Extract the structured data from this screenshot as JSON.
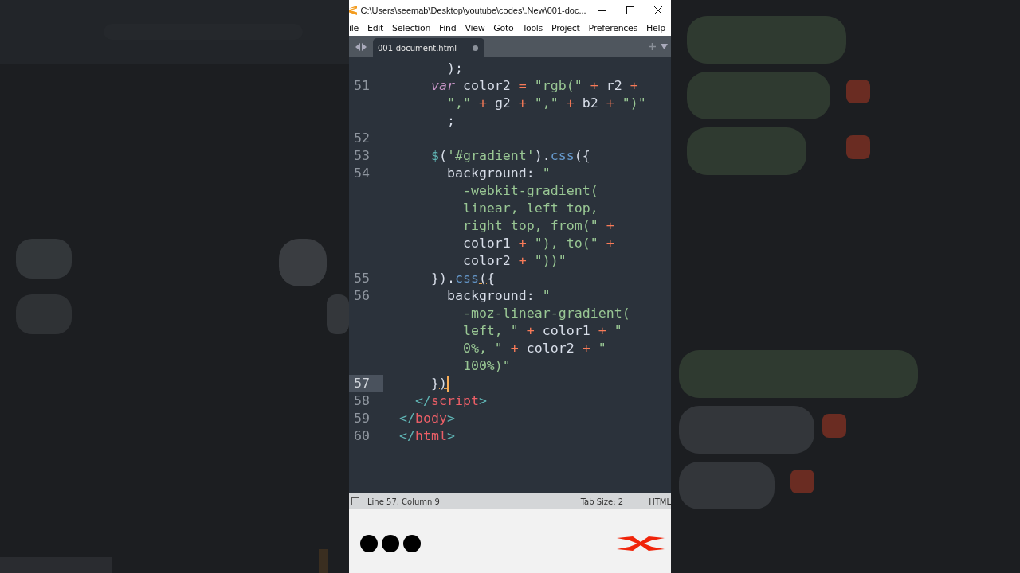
{
  "window": {
    "title": "C:\\Users\\seemab\\Desktop\\youtube\\codes\\.New\\001-doc..."
  },
  "menu": [
    "ile",
    "Edit",
    "Selection",
    "Find",
    "View",
    "Goto",
    "Tools",
    "Project",
    "Preferences",
    "Help"
  ],
  "tabs": [
    {
      "label": "001-document.html",
      "selected": true,
      "modified": true
    }
  ],
  "editor": {
    "lines": [
      {
        "segments": [
          {
            "text": "        );",
            "kind": "plain"
          }
        ]
      },
      {
        "number": "51",
        "segments": [
          {
            "text": "      var",
            "kind": "keyword"
          },
          {
            "text": " color2 ",
            "kind": "plain"
          },
          {
            "text": "=",
            "kind": "operator"
          },
          {
            "text": " \"rgb(\" ",
            "kind": "string"
          },
          {
            "text": "+",
            "kind": "operator"
          },
          {
            "text": " r2 ",
            "kind": "plain"
          },
          {
            "text": "+",
            "kind": "operator"
          }
        ]
      },
      {
        "segments": [
          {
            "text": "        \",\" ",
            "kind": "string"
          },
          {
            "text": "+",
            "kind": "operator"
          },
          {
            "text": " g2 ",
            "kind": "plain"
          },
          {
            "text": "+",
            "kind": "operator"
          },
          {
            "text": " \",\" ",
            "kind": "string"
          },
          {
            "text": "+",
            "kind": "operator"
          },
          {
            "text": " b2 ",
            "kind": "plain"
          },
          {
            "text": "+",
            "kind": "operator"
          },
          {
            "text": " \")\"",
            "kind": "string"
          }
        ]
      },
      {
        "segments": [
          {
            "text": "        ;",
            "kind": "plain"
          }
        ]
      },
      {
        "number": "52"
      },
      {
        "number": "53",
        "segments": [
          {
            "text": "      $",
            "kind": "dollar"
          },
          {
            "text": "(",
            "kind": "plain"
          },
          {
            "text": "'#gradient'",
            "kind": "string"
          },
          {
            "text": ").",
            "kind": "plain"
          },
          {
            "text": "css",
            "kind": "func"
          },
          {
            "text": "({",
            "kind": "plain"
          }
        ]
      },
      {
        "number": "54",
        "segments": [
          {
            "text": "        background: ",
            "kind": "plain"
          },
          {
            "text": "\"",
            "kind": "string"
          }
        ]
      },
      {
        "segments": [
          {
            "text": "          -webkit-gradient(",
            "kind": "string"
          }
        ]
      },
      {
        "segments": [
          {
            "text": "          linear, left top,",
            "kind": "string"
          }
        ]
      },
      {
        "segments": [
          {
            "text": "          right top, from(\" ",
            "kind": "string"
          },
          {
            "text": "+",
            "kind": "operator"
          }
        ]
      },
      {
        "segments": [
          {
            "text": "          color1 ",
            "kind": "plain"
          },
          {
            "text": "+",
            "kind": "operator"
          },
          {
            "text": " \"), to(\" ",
            "kind": "string"
          },
          {
            "text": "+",
            "kind": "operator"
          }
        ]
      },
      {
        "segments": [
          {
            "text": "          color2 ",
            "kind": "plain"
          },
          {
            "text": "+",
            "kind": "operator"
          },
          {
            "text": " \"))\"",
            "kind": "string"
          }
        ]
      },
      {
        "number": "55",
        "segments": [
          {
            "text": "      }).",
            "kind": "plain"
          },
          {
            "text": "css",
            "kind": "func"
          },
          {
            "text": "(",
            "kind": "match"
          },
          {
            "text": "{",
            "kind": "plain"
          }
        ]
      },
      {
        "number": "56",
        "segments": [
          {
            "text": "        background: ",
            "kind": "plain"
          },
          {
            "text": "\"",
            "kind": "string"
          }
        ]
      },
      {
        "segments": [
          {
            "text": "          -moz-linear-gradient(",
            "kind": "string"
          }
        ]
      },
      {
        "segments": [
          {
            "text": "          left, \" ",
            "kind": "string"
          },
          {
            "text": "+",
            "kind": "operator"
          },
          {
            "text": " color1 ",
            "kind": "plain"
          },
          {
            "text": "+",
            "kind": "operator"
          },
          {
            "text": " \"",
            "kind": "string"
          }
        ]
      },
      {
        "segments": [
          {
            "text": "          0%, \" ",
            "kind": "string"
          },
          {
            "text": "+",
            "kind": "operator"
          },
          {
            "text": " color2 ",
            "kind": "plain"
          },
          {
            "text": "+",
            "kind": "operator"
          },
          {
            "text": " \"",
            "kind": "string"
          }
        ]
      },
      {
        "segments": [
          {
            "text": "          100%)\"",
            "kind": "string"
          }
        ]
      },
      {
        "number": "57",
        "current": true,
        "segments": [
          {
            "text": "      }",
            "kind": "plain"
          },
          {
            "text": ")",
            "kind": "match"
          }
        ]
      },
      {
        "number": "58",
        "segments": [
          {
            "text": "    </",
            "kind": "tagpunct"
          },
          {
            "text": "script",
            "kind": "tag"
          },
          {
            "text": ">",
            "kind": "tagpunct"
          }
        ]
      },
      {
        "number": "59",
        "segments": [
          {
            "text": "  </",
            "kind": "tagpunct"
          },
          {
            "text": "body",
            "kind": "tag"
          },
          {
            "text": ">",
            "kind": "tagpunct"
          }
        ]
      },
      {
        "number": "60",
        "segments": [
          {
            "text": "  </",
            "kind": "tagpunct"
          },
          {
            "text": "html",
            "kind": "tag"
          },
          {
            "text": ">",
            "kind": "tagpunct"
          }
        ]
      }
    ]
  },
  "status_bar": {
    "position": "Line 57, Column 9",
    "tab_size": "Tab Size: 2",
    "syntax": "HTML"
  }
}
